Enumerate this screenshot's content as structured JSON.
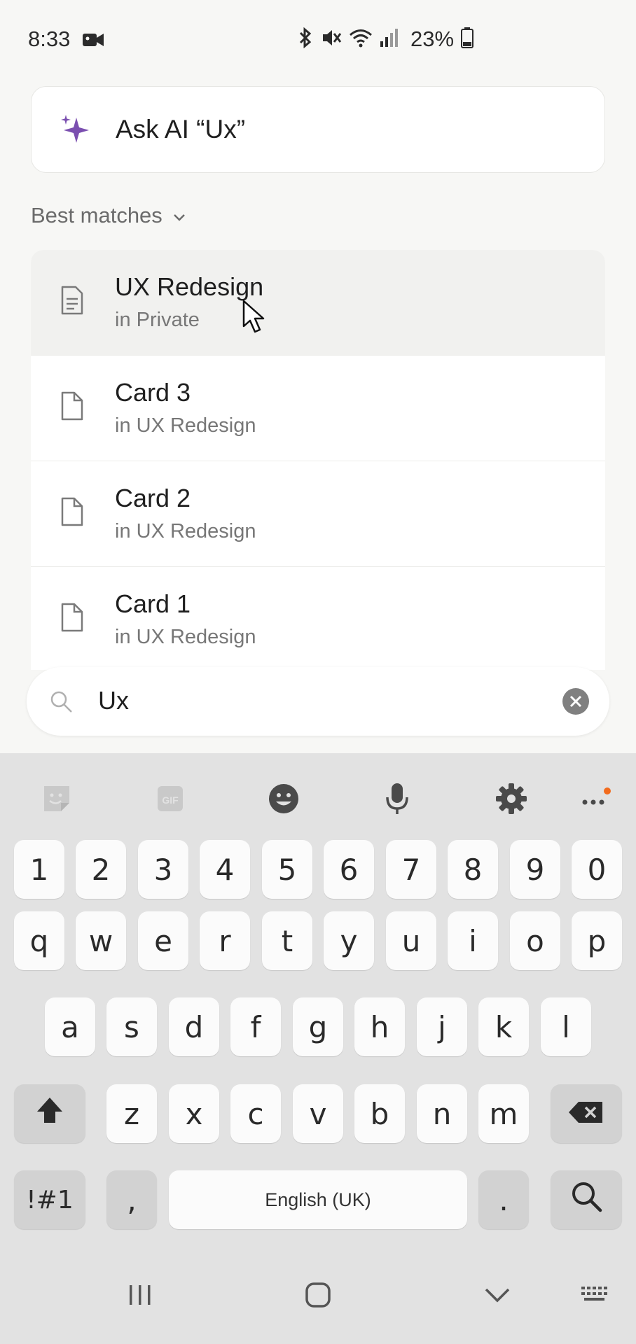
{
  "status_bar": {
    "time": "8:33",
    "battery": "23%"
  },
  "ask_ai": {
    "label": "Ask AI “Ux”"
  },
  "section": {
    "title": "Best matches"
  },
  "results": [
    {
      "title": "UX Redesign",
      "location": "in Private"
    },
    {
      "title": "Card 3",
      "location": "in UX Redesign"
    },
    {
      "title": "Card 2",
      "location": "in UX Redesign"
    },
    {
      "title": "Card 1",
      "location": "in UX Redesign"
    }
  ],
  "search": {
    "value": "Ux"
  },
  "keyboard": {
    "number_row": [
      "1",
      "2",
      "3",
      "4",
      "5",
      "6",
      "7",
      "8",
      "9",
      "0"
    ],
    "row1": [
      "q",
      "w",
      "e",
      "r",
      "t",
      "y",
      "u",
      "i",
      "o",
      "p"
    ],
    "row2": [
      "a",
      "s",
      "d",
      "f",
      "g",
      "h",
      "j",
      "k",
      "l"
    ],
    "row3": [
      "z",
      "x",
      "c",
      "v",
      "b",
      "n",
      "m"
    ],
    "symbols_label": "!#1",
    "comma": ",",
    "space_label": "English (UK)",
    "period": ".",
    "gif_label": "GIF"
  },
  "colors": {
    "accent_purple": "#7b4fb0",
    "notification_dot": "#f26b1d"
  }
}
